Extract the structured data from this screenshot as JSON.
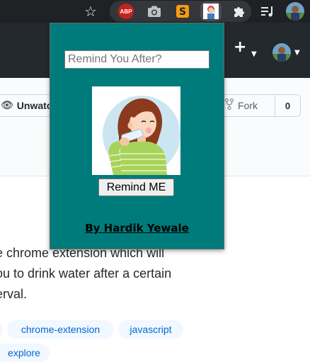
{
  "browser": {
    "bookmark_icon": "star-icon",
    "extensions": [
      {
        "name": "adblock-plus",
        "label": "ABP"
      },
      {
        "name": "camera-extension",
        "icon": "camera-icon"
      },
      {
        "name": "s-extension",
        "icon": "s-icon"
      },
      {
        "name": "water-reminder",
        "icon": "girl-drinking-icon"
      }
    ],
    "extensions_menu_icon": "puzzle-icon",
    "media_icon": "media-control-icon",
    "profile_icon": "profile-avatar-icon"
  },
  "github": {
    "header": {
      "new_icon": "+"
    },
    "repo_actions": {
      "unwatch_label": "Unwatch",
      "fork_label": "Fork",
      "fork_count": "0"
    },
    "about": {
      "lines": [
        "e chrome extension which will",
        "ou to drink water after a certain",
        "erval."
      ]
    },
    "topics": [
      "chrome-extension",
      "javascript",
      "explore"
    ]
  },
  "popup": {
    "input_placeholder": "Remind You After?",
    "input_value": "",
    "button_label": "Remind ME",
    "author": "By Hardik Yewale",
    "colors": {
      "background": "#007b7b"
    }
  }
}
